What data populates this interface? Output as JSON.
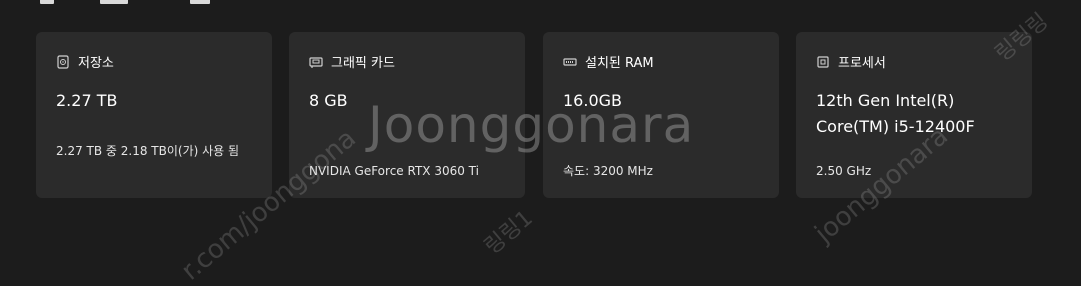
{
  "cards": [
    {
      "header_label": "저장소",
      "icon": "hard-drive-icon",
      "value": "2.27 TB",
      "detail": "2.27 TB 중 2.18 TB이(가) 사용 됨"
    },
    {
      "header_label": "그래픽 카드",
      "icon": "graphics-card-icon",
      "value": "8 GB",
      "detail": "NVIDIA GeForce RTX 3060 Ti"
    },
    {
      "header_label": "설치된 RAM",
      "icon": "ram-icon",
      "value": "16.0GB",
      "detail": "속도: 3200 MHz"
    },
    {
      "header_label": "프로세서",
      "icon": "processor-icon",
      "value": "12th Gen Intel(R) Core(TM) i5-12400F",
      "detail": "2.50 GHz"
    }
  ],
  "watermark": {
    "main": "Joonggonara",
    "diag_left": "r.com/joonggona",
    "diag_right": "joonggonara",
    "diag_corner": "링링링",
    "diag_bottom": "링링1"
  }
}
